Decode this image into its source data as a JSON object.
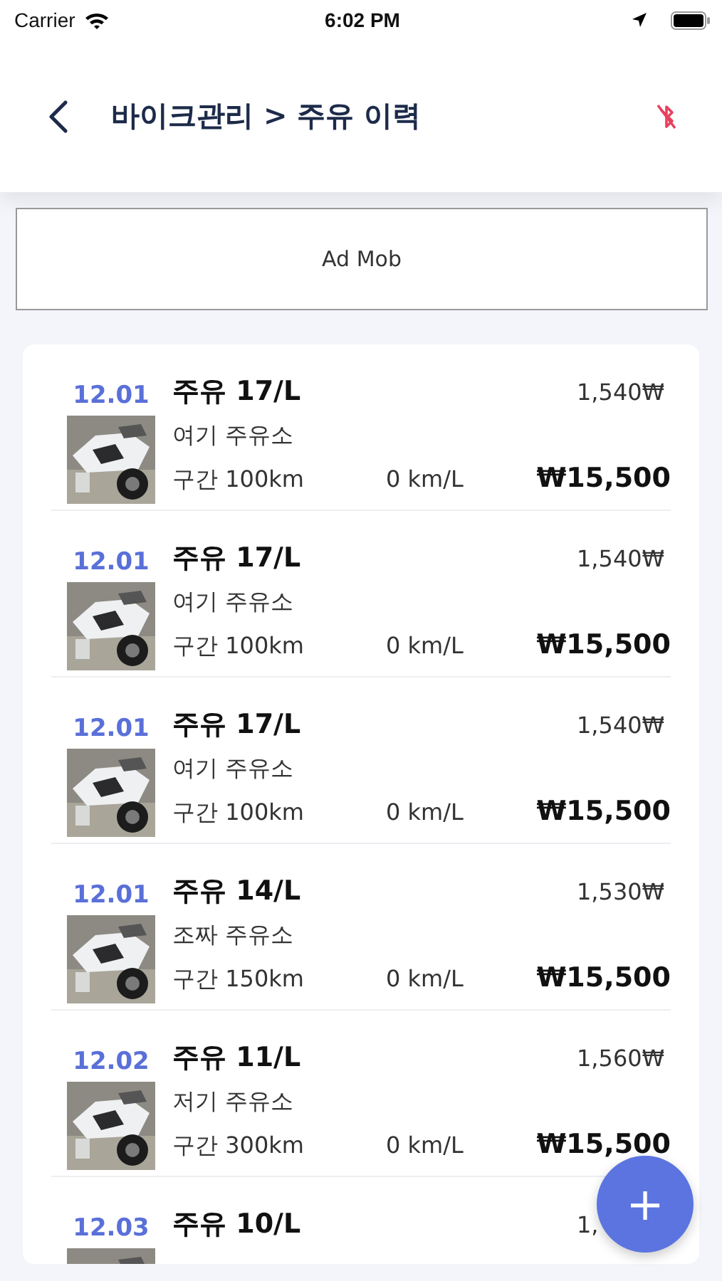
{
  "status_bar": {
    "carrier": "Carrier",
    "time": "6:02 PM"
  },
  "header": {
    "title": "바이크관리 > 주유 이력"
  },
  "ad": {
    "label": "Ad Mob"
  },
  "records": [
    {
      "date": "12.01",
      "title": "주유 17/L",
      "price": "1,540₩",
      "place": "여기 주유소",
      "section": "구간 100km",
      "efficiency": "0 km/L",
      "total": "₩15,500"
    },
    {
      "date": "12.01",
      "title": "주유 17/L",
      "price": "1,540₩",
      "place": "여기 주유소",
      "section": "구간 100km",
      "efficiency": "0 km/L",
      "total": "₩15,500"
    },
    {
      "date": "12.01",
      "title": "주유 17/L",
      "price": "1,540₩",
      "place": "여기 주유소",
      "section": "구간 100km",
      "efficiency": "0 km/L",
      "total": "₩15,500"
    },
    {
      "date": "12.01",
      "title": "주유 14/L",
      "price": "1,530₩",
      "place": "조짜 주유소",
      "section": "구간 150km",
      "efficiency": "0 km/L",
      "total": "₩15,500"
    },
    {
      "date": "12.02",
      "title": "주유 11/L",
      "price": "1,560₩",
      "place": "저기 주유소",
      "section": "구간 300km",
      "efficiency": "0 km/L",
      "total": "₩15,500"
    },
    {
      "date": "12.03",
      "title": "주유 10/L",
      "price": "1,"
    }
  ],
  "fab": {
    "label": "+"
  }
}
